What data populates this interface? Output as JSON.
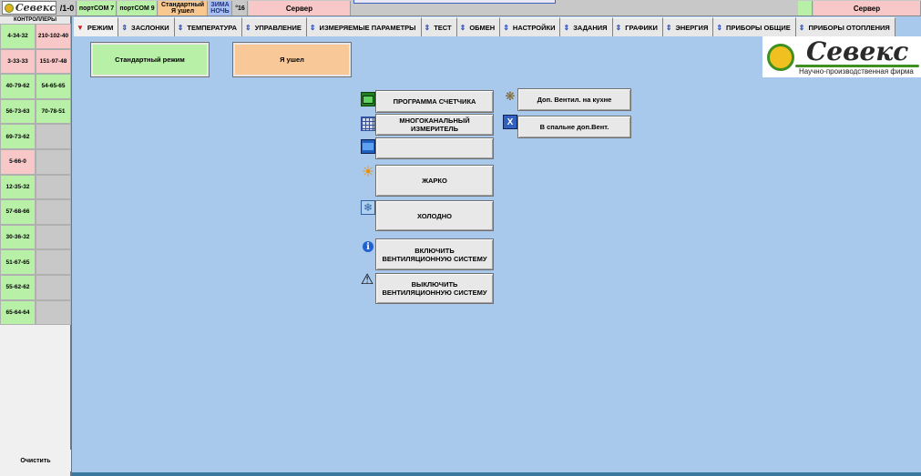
{
  "topbar": {
    "logo_text": "Севекс",
    "ratio": "/1-0",
    "port7": "портCOM 7",
    "port9": "портCOM 9",
    "mode_line1": "Стандартный",
    "mode_line2": "Я ушел",
    "season_line1": "ЗИМА",
    "season_line2": "НОЧЬ",
    "temp": "°16",
    "server_left": "Сервер",
    "server_right": "Сервер"
  },
  "left_panel": {
    "header": "КОНТРОЛЛЕРЫ",
    "rows": [
      [
        "4-34-32",
        "210-102-40"
      ],
      [
        "3-33-33",
        "151-97-48"
      ],
      [
        "40-79-62",
        "54-65-65"
      ],
      [
        "56-73-63",
        "70-78-51"
      ],
      [
        "69-73-62",
        ""
      ],
      [
        "5-66-0",
        ""
      ],
      [
        "12-35-32",
        ""
      ],
      [
        "57-68-66",
        ""
      ],
      [
        "30-36-32",
        ""
      ],
      [
        "51-67-65",
        ""
      ],
      [
        "55-62-62",
        ""
      ],
      [
        "65-64-64",
        ""
      ]
    ],
    "clear_label": "Очистить"
  },
  "tabs": [
    {
      "label": "РЕЖИМ",
      "active": true
    },
    {
      "label": "ЗАСЛОНКИ",
      "active": false
    },
    {
      "label": "ТЕМПЕРАТУРА",
      "active": false
    },
    {
      "label": "УПРАВЛЕНИЕ",
      "active": false
    },
    {
      "label": "ИЗМЕРЯЕМЫЕ ПАРАМЕТРЫ",
      "active": false
    },
    {
      "label": "ТЕСТ",
      "active": false
    },
    {
      "label": "ОБМЕН",
      "active": false
    },
    {
      "label": "НАСТРОЙКИ",
      "active": false
    },
    {
      "label": "ЗАДАНИЯ",
      "active": false
    },
    {
      "label": "ГРАФИКИ",
      "active": false
    },
    {
      "label": "ЭНЕРГИЯ",
      "active": false
    },
    {
      "label": "ПРИБОРЫ ОБЩИЕ",
      "active": false
    },
    {
      "label": "ПРИБОРЫ ОТОПЛЕНИЯ",
      "active": false
    }
  ],
  "modes": {
    "standard": "Стандартный режим",
    "away": "Я ушел"
  },
  "brand": {
    "name": "Севекс",
    "subtitle": "Научно-производственная фирма"
  },
  "actions": {
    "counter_program": "ПРОГРАММА СЧЕТЧИКА",
    "multichannel": "МНОГОКАНАЛЬНЫЙ ИЗМЕРИТЕЛЬ",
    "blank": "",
    "hot": "ЖАРКО",
    "cold": "ХОЛОДНО",
    "vent_on_1": "ВКЛЮЧИТЬ",
    "vent_on_2": "ВЕНТИЛЯЦИОННУЮ СИСТЕМУ",
    "vent_off_1": "ВЫКЛЮЧИТЬ",
    "vent_off_2": "ВЕНТИЛЯЦИОННУЮ СИСТЕМУ",
    "kitchen_vent": "Доп. Вентил. на кухне",
    "bedroom_vent": "В спальне доп.Вент."
  },
  "colors": {
    "background": "#a8c8ec",
    "ok_green": "#b8f0a8",
    "alarm_pink": "#f8c8c8",
    "away_orange": "#f8c898"
  }
}
